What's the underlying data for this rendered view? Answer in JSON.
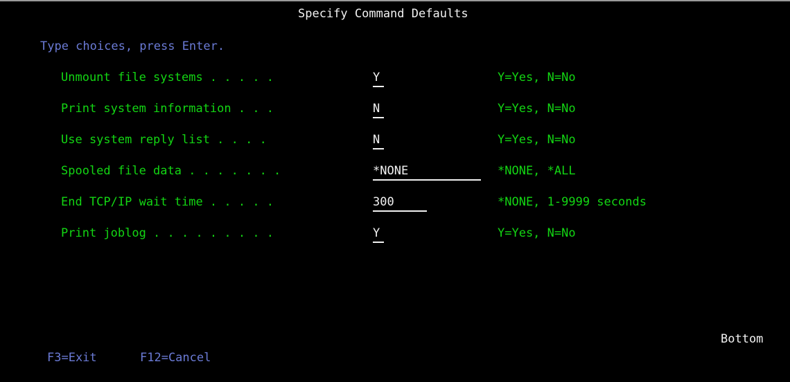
{
  "screen": {
    "title": "Specify Command Defaults",
    "instruction": "Type choices, press Enter.",
    "position_indicator": "Bottom",
    "colors": {
      "background": "#000000",
      "label": "#13d613",
      "instruction": "#6b7bd6",
      "value": "#f2f2f2",
      "title": "#f2f2f2",
      "function_key": "#6b7bd6"
    }
  },
  "fields": [
    {
      "label": "Unmount file systems . . . . .",
      "value": "Y",
      "field_width": 1,
      "help": "Y=Yes, N=No"
    },
    {
      "label": "Print system information . . .",
      "value": "N",
      "field_width": 1,
      "help": "Y=Yes, N=No"
    },
    {
      "label": "Use system reply list . . . .",
      "value": "N",
      "field_width": 1,
      "help": "Y=Yes, N=No"
    },
    {
      "label": "Spooled file data . . . . . . .",
      "value": "*NONE",
      "field_width": 10,
      "help": "*NONE, *ALL"
    },
    {
      "label": "End TCP/IP wait time . . . . .",
      "value": "300",
      "field_width": 5,
      "help": "*NONE, 1-9999 seconds"
    },
    {
      "label": "Print joblog . . . . . . . . .",
      "value": "Y",
      "field_width": 1,
      "help": "Y=Yes, N=No"
    }
  ],
  "function_keys": [
    {
      "label": "F3=Exit"
    },
    {
      "label": "F12=Cancel"
    }
  ]
}
